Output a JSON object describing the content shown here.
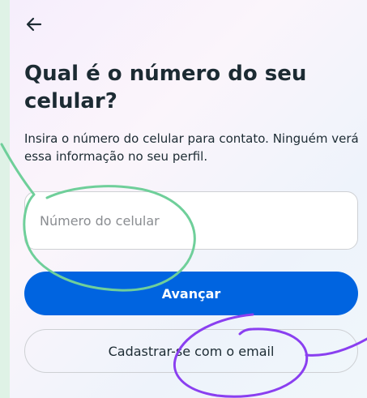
{
  "header": {
    "back_icon": "arrow-left-icon"
  },
  "content": {
    "title": "Qual é o número do seu celular?",
    "subtitle": "Insira o número do celular para contato. Ninguém verá essa informação no seu perfil."
  },
  "phone_field": {
    "placeholder": "Número do celular",
    "value": ""
  },
  "buttons": {
    "next_label": "Avançar",
    "email_signup_label": "Cadastrar-se com o email"
  },
  "colors": {
    "primary": "#0064e0",
    "annotation_green": "#6fcf9a",
    "annotation_purple": "#8a3ff0"
  }
}
